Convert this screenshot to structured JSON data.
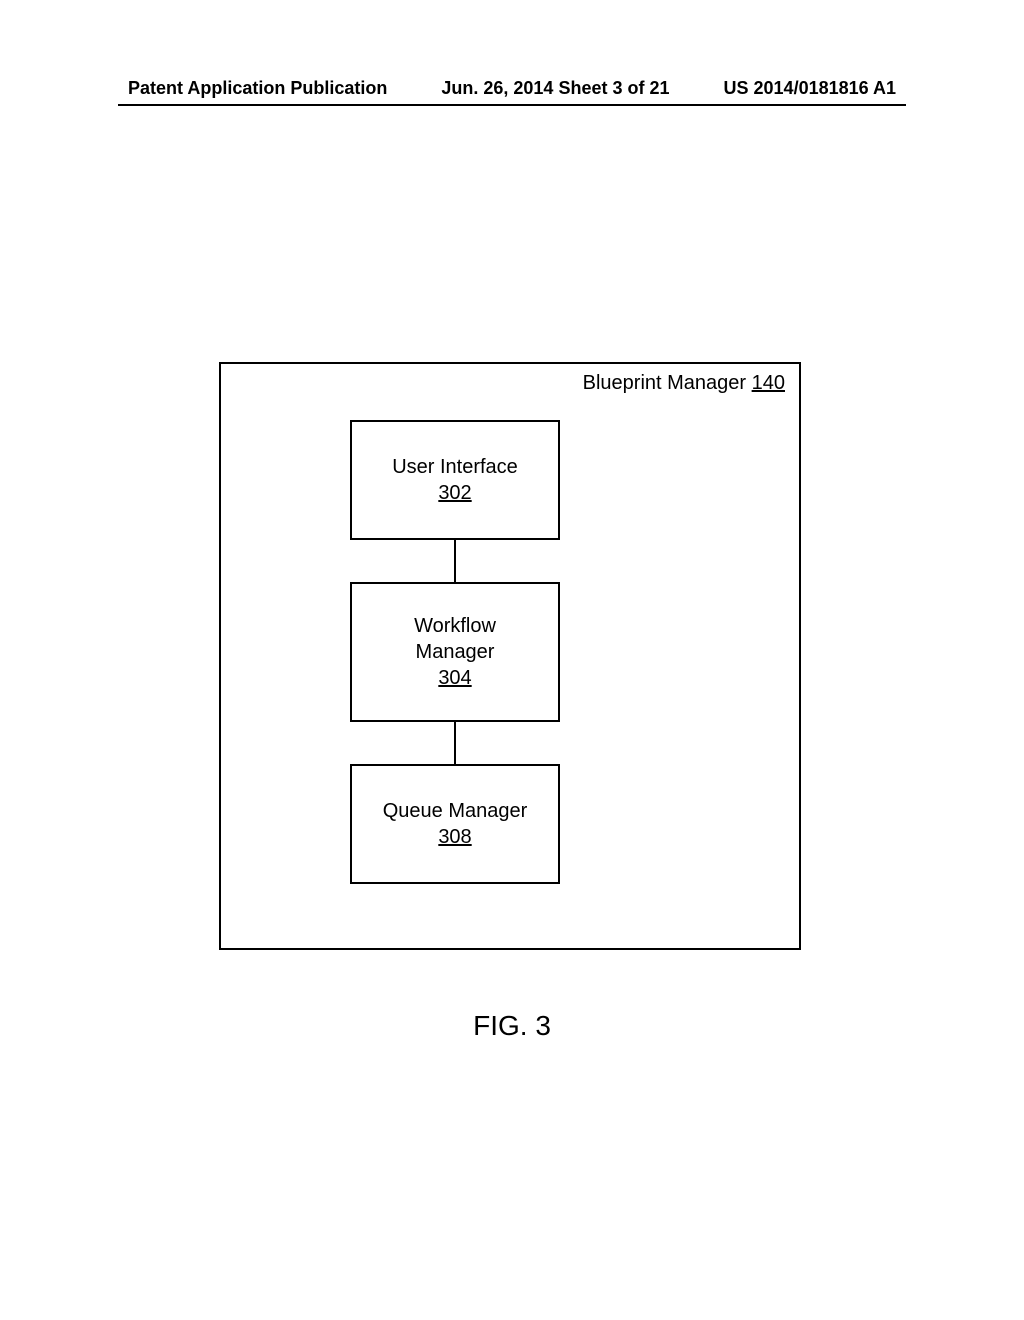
{
  "header": {
    "left": "Patent Application Publication",
    "center": "Jun. 26, 2014 Sheet 3 of 21",
    "right": "US 2014/0181816 A1"
  },
  "outer": {
    "label_text": "Blueprint Manager ",
    "label_num": "140"
  },
  "blocks": {
    "b1_line1": "User Interface",
    "b1_num": "302",
    "b2_line1": "Workflow",
    "b2_line2": "Manager",
    "b2_num": "304",
    "b3_line1": "Queue Manager",
    "b3_num": "308"
  },
  "figure_label": "FIG. 3"
}
